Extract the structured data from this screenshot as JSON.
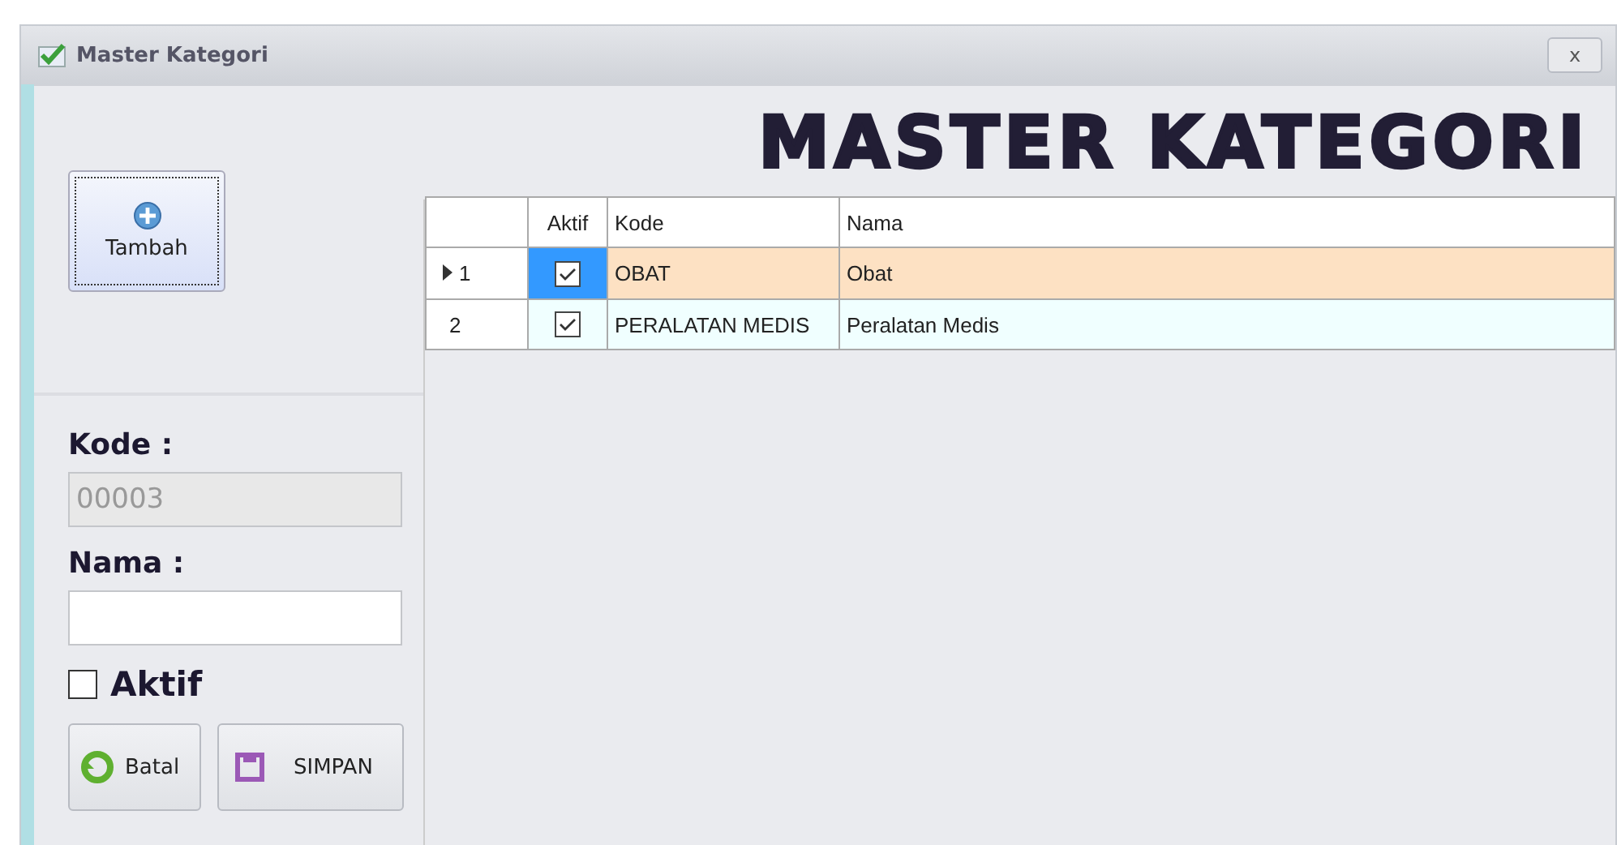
{
  "window": {
    "title": "Master Kategori",
    "close": "x"
  },
  "heading": "MASTER KATEGORI",
  "add_button": {
    "label": "Tambah"
  },
  "form": {
    "kode_label": "Kode :",
    "kode_value": "00003",
    "kode_disabled": true,
    "nama_label": "Nama :",
    "aktif": {
      "label": "Aktif",
      "checked": false
    }
  },
  "buttons": [
    {
      "kind": "cancel",
      "label": "Batal"
    },
    {
      "kind": "save",
      "label": "SIMPAN"
    }
  ],
  "table": {
    "columns": [
      "Aktif",
      "Kode",
      "Nama"
    ],
    "rows": [
      {
        "number": "1",
        "selected": true,
        "aktif": true,
        "kode": "OBAT",
        "nama": "Obat"
      },
      {
        "number": "2",
        "selected": false,
        "aktif": true,
        "kode": "PERALATAN MEDIS",
        "nama": "Peralatan Medis"
      }
    ]
  }
}
